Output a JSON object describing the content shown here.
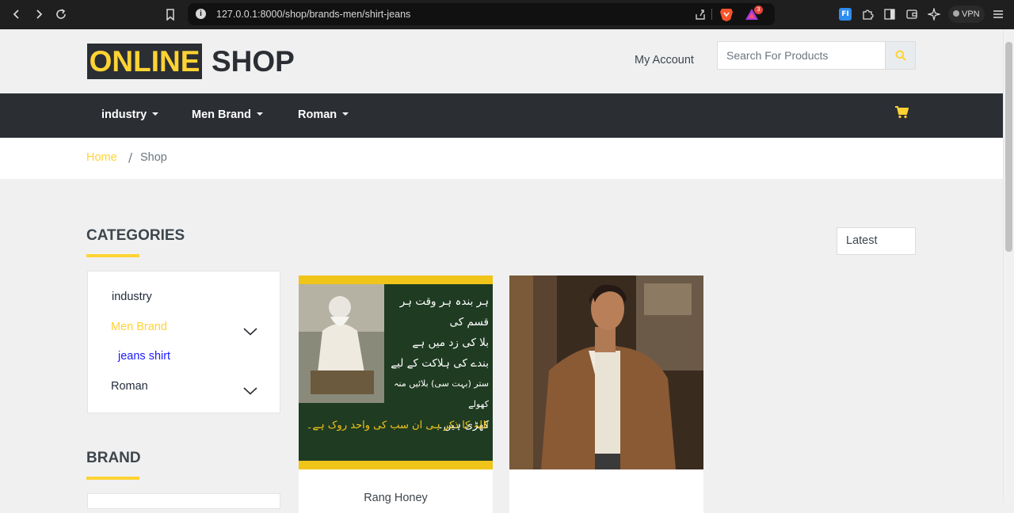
{
  "browser": {
    "url": "127.0.0.1:8000/shop/brands-men/shirt-jeans",
    "vpn_label": "VPN",
    "badge_count": "3"
  },
  "header": {
    "logo_part1": "ONLINE",
    "logo_part2": "SHOP",
    "account_label": "My Account",
    "search_placeholder": "Search For Products"
  },
  "nav": {
    "items": [
      {
        "label": "industry"
      },
      {
        "label": "Men Brand"
      },
      {
        "label": "Roman"
      }
    ]
  },
  "breadcrumb": {
    "home": "Home",
    "separator": "/",
    "current": "Shop"
  },
  "categories": {
    "title": "CATEGORIES",
    "items": [
      {
        "label": "industry"
      },
      {
        "label": "Men Brand"
      },
      {
        "label": "jeans shirt"
      },
      {
        "label": "Roman"
      }
    ]
  },
  "brand": {
    "title": "BRAND"
  },
  "sort": {
    "selected": "Latest"
  },
  "products": [
    {
      "name": "Rang Honey",
      "image_text": {
        "lines": [
          "ہر بندہ ہر وقت ہر قسم کی",
          "بلا کی زد میں ہے",
          "بندے کی ہلاکت کے لیے",
          "ستر (بہت سی) بلائیں منہ کھولے",
          "کھڑی ہیں۔",
          "اللہ کا ذکر ہی ان سب کی واحد روک ہے۔"
        ]
      }
    },
    {
      "name": ""
    }
  ],
  "colors": {
    "accent": "#ffd333",
    "dark": "#2b2e33",
    "text": "#3d464d",
    "link_blue": "#1a1aff"
  }
}
